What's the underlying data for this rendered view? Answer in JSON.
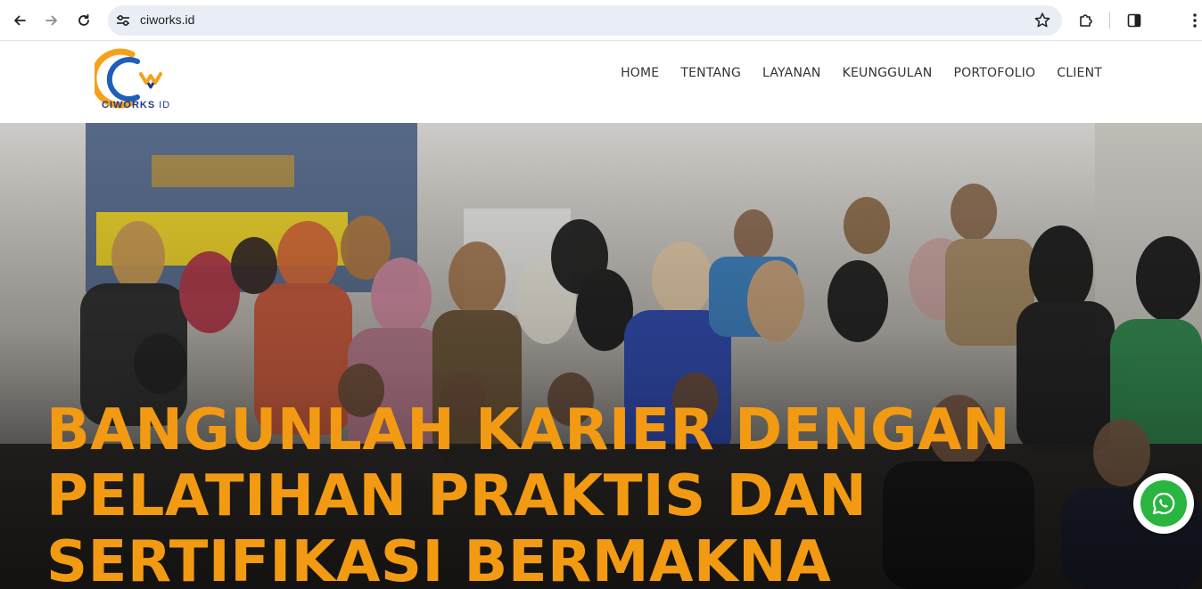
{
  "browser": {
    "url": "ciworks.id"
  },
  "site": {
    "logo_text": "CIWORKS",
    "logo_suffix": " ID",
    "menu": [
      "HOME",
      "TENTANG",
      "LAYANAN",
      "KEUNGGULAN",
      "PORTOFOLIO",
      "CLIENT"
    ]
  },
  "hero": {
    "headline_lines": [
      "BANGUNLAH KARIER DENGAN",
      "PELATIHAN PRAKTIS DAN",
      "SERTIFIKASI BERMAKNA"
    ]
  },
  "colors": {
    "headline": "#f39a13",
    "whatsapp": "#2ab540",
    "logo_blue": "#1e3b8a",
    "logo_orange": "#f5a11a"
  },
  "icons": {
    "back": "arrow-left-icon",
    "forward": "arrow-right-icon",
    "reload": "reload-icon",
    "site_info": "tune-icon",
    "bookmark": "star-icon",
    "extensions": "puzzle-icon",
    "side_panel": "side-panel-icon",
    "menu": "kebab-menu-icon",
    "whatsapp": "whatsapp-icon"
  }
}
